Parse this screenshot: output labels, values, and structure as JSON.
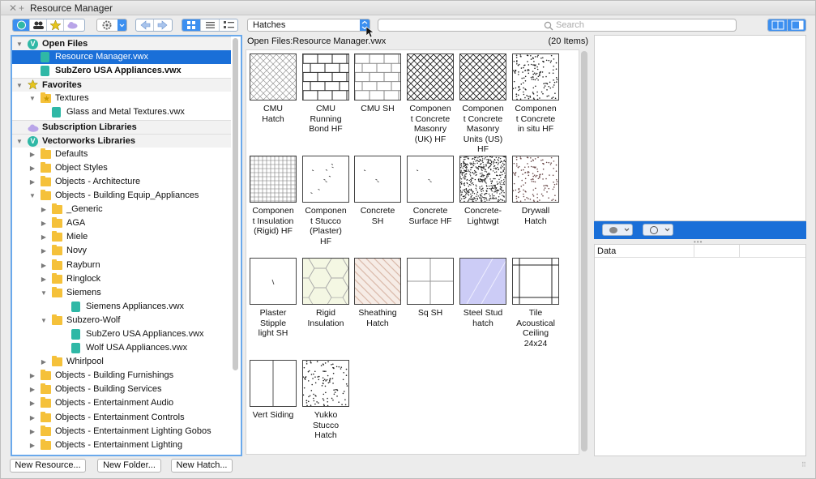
{
  "window": {
    "title": "Resource Manager"
  },
  "toolbar": {
    "resource_type": "Hatches",
    "search_placeholder": "Search"
  },
  "browser": {
    "path": "Open Files:Resource Manager.vwx",
    "count": "(20 Items)"
  },
  "tree": [
    {
      "label": "Open Files",
      "level": 0,
      "section": true,
      "icon": "vw-badge-icon",
      "expanded": true
    },
    {
      "label": "Resource Manager.vwx",
      "level": 1,
      "icon": "vwx-file-icon",
      "selected": true
    },
    {
      "label": "SubZero USA Appliances.vwx",
      "level": 1,
      "icon": "vwx-file-icon",
      "bold": true
    },
    {
      "label": "Favorites",
      "level": 0,
      "section": true,
      "icon": "star-icon",
      "expanded": true
    },
    {
      "label": "Textures",
      "level": 1,
      "icon": "folder-star-icon",
      "expanded": true
    },
    {
      "label": "Glass and Metal Textures.vwx",
      "level": 2,
      "icon": "vwx-file-icon"
    },
    {
      "label": "Subscription Libraries",
      "level": 0,
      "section": true,
      "icon": "cloud-icon"
    },
    {
      "label": "Vectorworks Libraries",
      "level": 0,
      "section": true,
      "icon": "vw-badge-icon",
      "expanded": true
    },
    {
      "label": "Defaults",
      "level": 1,
      "icon": "folder-icon",
      "collapsed": true
    },
    {
      "label": "Object Styles",
      "level": 1,
      "icon": "folder-icon",
      "collapsed": true
    },
    {
      "label": "Objects - Architecture",
      "level": 1,
      "icon": "folder-icon",
      "collapsed": true
    },
    {
      "label": "Objects - Building Equip_Appliances",
      "level": 1,
      "icon": "folder-icon",
      "expanded": true
    },
    {
      "label": "_Generic",
      "level": 2,
      "icon": "folder-icon",
      "collapsed": true
    },
    {
      "label": "AGA",
      "level": 2,
      "icon": "folder-icon",
      "collapsed": true
    },
    {
      "label": "Miele",
      "level": 2,
      "icon": "folder-icon",
      "collapsed": true
    },
    {
      "label": "Novy",
      "level": 2,
      "icon": "folder-icon",
      "collapsed": true
    },
    {
      "label": "Rayburn",
      "level": 2,
      "icon": "folder-icon",
      "collapsed": true
    },
    {
      "label": "Ringlock",
      "level": 2,
      "icon": "folder-icon",
      "collapsed": true
    },
    {
      "label": "Siemens",
      "level": 2,
      "icon": "folder-icon",
      "expanded": true
    },
    {
      "label": "Siemens Appliances.vwx",
      "level": 3,
      "icon": "vwx-file-icon"
    },
    {
      "label": "Subzero-Wolf",
      "level": 2,
      "icon": "folder-icon",
      "expanded": true
    },
    {
      "label": "SubZero USA Appliances.vwx",
      "level": 3,
      "icon": "vwx-file-icon"
    },
    {
      "label": "Wolf USA Appliances.vwx",
      "level": 3,
      "icon": "vwx-file-icon"
    },
    {
      "label": "Whirlpool",
      "level": 2,
      "icon": "folder-icon",
      "collapsed": true
    },
    {
      "label": "Objects - Building Furnishings",
      "level": 1,
      "icon": "folder-icon",
      "collapsed": true
    },
    {
      "label": "Objects - Building Services",
      "level": 1,
      "icon": "folder-icon",
      "collapsed": true
    },
    {
      "label": "Objects - Entertainment Audio",
      "level": 1,
      "icon": "folder-icon",
      "collapsed": true
    },
    {
      "label": "Objects - Entertainment Controls",
      "level": 1,
      "icon": "folder-icon",
      "collapsed": true
    },
    {
      "label": "Objects - Entertainment Lighting Gobos",
      "level": 1,
      "icon": "folder-icon",
      "collapsed": true
    },
    {
      "label": "Objects - Entertainment Lighting",
      "level": 1,
      "icon": "folder-icon",
      "collapsed": true
    }
  ],
  "hatches": [
    {
      "label": "CMU\nHatch",
      "pattern": "diag-grid-light"
    },
    {
      "label": "CMU\nRunning\nBond HF",
      "pattern": "brick-dark"
    },
    {
      "label": "CMU SH",
      "pattern": "brick-light"
    },
    {
      "label": "Componen\nt Concrete\nMasonry\n(UK) HF",
      "pattern": "diag-grid-dark"
    },
    {
      "label": "Componen\nt Concrete\nMasonry\nUnits (US)\nHF",
      "pattern": "diag-grid-dark"
    },
    {
      "label": "Componen\nt Concrete\nin situ HF",
      "pattern": "speckle-dense"
    },
    {
      "label": "Componen\nt Insulation\n(Rigid) HF",
      "pattern": "fine-grid"
    },
    {
      "label": "Componen\nt Stucco\n(Plaster)\nHF",
      "pattern": "sparse-marks"
    },
    {
      "label": "Concrete\nSH",
      "pattern": "sparse-light"
    },
    {
      "label": "Concrete\nSurface HF",
      "pattern": "sparse-light"
    },
    {
      "label": "Concrete-\nLightwgt",
      "pattern": "speckle-heavy"
    },
    {
      "label": "Drywall\nHatch",
      "pattern": "dots-pink"
    },
    {
      "label": "Plaster\nStipple\nlight SH",
      "pattern": "single-mark"
    },
    {
      "label": "Rigid\nInsulation",
      "pattern": "hexagon"
    },
    {
      "label": "Sheathing\nHatch",
      "pattern": "diag-beige"
    },
    {
      "label": "Sq SH",
      "pattern": "large-grid"
    },
    {
      "label": "Steel Stud\nhatch",
      "pattern": "lavender-diag"
    },
    {
      "label": "Tile\nAcoustical\nCeiling\n24x24",
      "pattern": "tile-grid"
    },
    {
      "label": "Vert Siding",
      "pattern": "vertical-line"
    },
    {
      "label": "Yukko\nStucco\nHatch",
      "pattern": "dots-black"
    }
  ],
  "info": {
    "data_label": "Data"
  },
  "buttons": {
    "new_resource": "New Resource...",
    "new_folder": "New Folder...",
    "new_hatch": "New Hatch..."
  }
}
